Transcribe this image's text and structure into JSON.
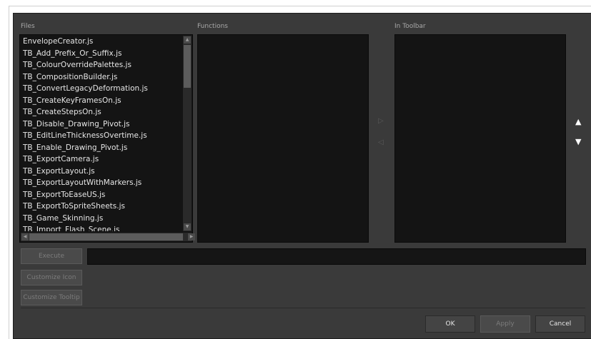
{
  "labels": {
    "files": "Files",
    "functions": "Functions",
    "in_toolbar": "In Toolbar"
  },
  "files": [
    "EnvelopeCreator.js",
    "TB_Add_Prefix_Or_Suffix.js",
    "TB_ColourOverridePalettes.js",
    "TB_CompositionBuilder.js",
    "TB_ConvertLegacyDeformation.js",
    "TB_CreateKeyFramesOn.js",
    "TB_CreateStepsOn.js",
    "TB_Disable_Drawing_Pivot.js",
    "TB_EditLineThicknessOvertime.js",
    "TB_Enable_Drawing_Pivot.js",
    "TB_ExportCamera.js",
    "TB_ExportLayout.js",
    "TB_ExportLayoutWithMarkers.js",
    "TB_ExportToEaseUS.js",
    "TB_ExportToSpriteSheets.js",
    "TB_Game_Skinning.js",
    "TB_Import_Flash_Scene.js"
  ],
  "arrows": {
    "add": "▷",
    "remove": "◁",
    "up": "▲",
    "down": "▼"
  },
  "buttons": {
    "execute": "Execute",
    "customize_icon": "Customize Icon",
    "customize_tooltip": "Customize Tooltip",
    "ok": "OK",
    "apply": "Apply",
    "cancel": "Cancel"
  },
  "colors": {
    "dialog_bg": "#3a3a3a",
    "list_bg": "#141414"
  }
}
